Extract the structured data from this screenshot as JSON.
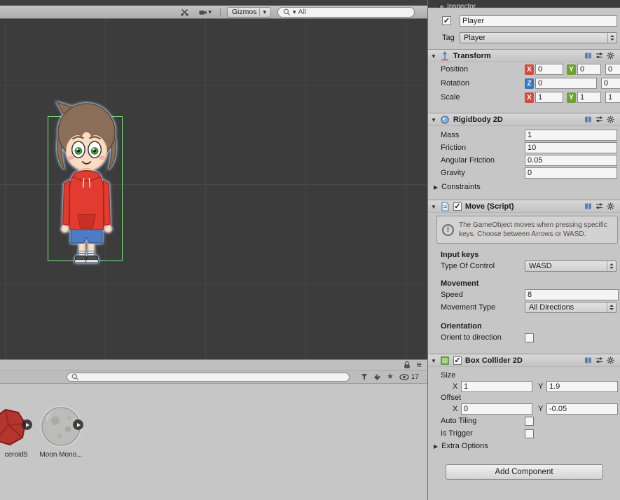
{
  "scene_toolbar": {
    "gizmos_label": "Gizmos",
    "search_value": "All"
  },
  "project": {
    "count": "17",
    "assets": [
      {
        "label": "ceroid5"
      },
      {
        "label": "Moon Mono..."
      }
    ]
  },
  "inspector": {
    "tab": "Inspector",
    "name": "Player",
    "tag_label": "Tag",
    "tag_value": "Player",
    "headers": {
      "transform": "Transform",
      "rigidbody": "Rigidbody 2D",
      "move": "Move (Script)",
      "collider": "Box Collider 2D"
    },
    "transform": {
      "axis_x": "X",
      "axis_y": "Y",
      "axis_z": "Z",
      "position_label": "Position",
      "position_x": "0",
      "position_y": "0",
      "position_z": "0",
      "rotation_label": "Rotation",
      "rotation_z": "0",
      "rotation_extra": "0",
      "scale_label": "Scale",
      "scale_x": "1",
      "scale_y": "1",
      "scale_z": "1"
    },
    "rigidbody": {
      "mass_label": "Mass",
      "mass": "1",
      "friction_label": "Friction",
      "friction": "10",
      "angular_label": "Angular Friction",
      "angular": "0.05",
      "gravity_label": "Gravity",
      "gravity": "0",
      "constraints_label": "Constraints"
    },
    "move": {
      "help": "The GameObject moves when pressing specific keys. Choose between Arrows or WASD.",
      "input_keys": "Input keys",
      "type_label": "Type Of Control",
      "type_value": "WASD",
      "movement": "Movement",
      "speed_label": "Speed",
      "speed": "8",
      "movement_type_label": "Movement Type",
      "movement_type_value": "All Directions",
      "orientation": "Orientation",
      "orient_label": "Orient to direction"
    },
    "collider": {
      "size_label": "Size",
      "x_letter": "X",
      "y_letter": "Y",
      "size_x": "1",
      "size_y": "1.9",
      "offset_label": "Offset",
      "offset_x": "0",
      "offset_y": "-0.05",
      "auto_tiling": "Auto Tiling",
      "is_trigger": "Is Trigger",
      "extra_options": "Extra Options"
    },
    "add_component": "Add Component"
  }
}
